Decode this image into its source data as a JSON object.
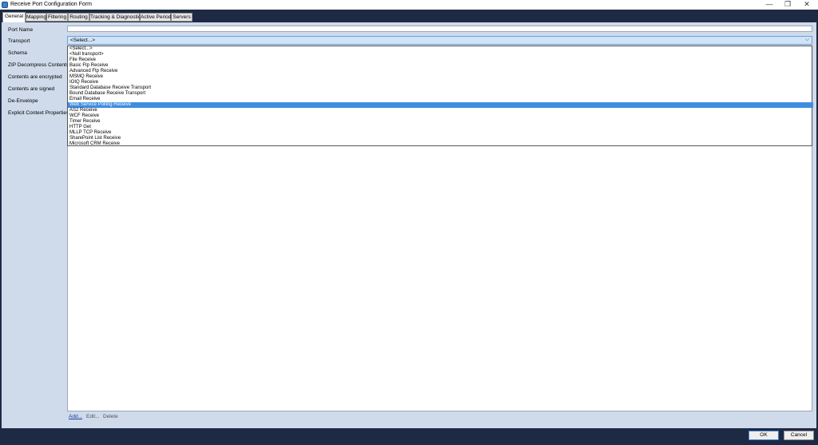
{
  "window": {
    "title": "Receive Port Configuration Form",
    "minimize_glyph": "—",
    "maximize_glyph": "❐",
    "close_glyph": "✕"
  },
  "tabs": [
    "General",
    "Mapping",
    "Filtering",
    "Routing",
    "Tracking & Diagnostics",
    "Active Period",
    "Servers"
  ],
  "active_tab": "General",
  "labels": {
    "port_name": "Port Name",
    "transport": "Transport",
    "schema": "Schema",
    "zip": "ZIP Decompress Contents",
    "encrypted": "Contents are encrypted",
    "signed": "Contents are signed",
    "de_envelope": "De-Envelope",
    "context_props": "Explicit Context Properties"
  },
  "fields": {
    "port_name_value": "",
    "transport_value": "<Select...>"
  },
  "transport_options": [
    "<Select...>",
    "<Null transport>",
    "File Receive",
    "Basic Ftp Receive",
    "Advanced Ftp Receive",
    "MSMQ Receive",
    "IOIQ Receive",
    "Standard Database Receive Transport",
    "Bound Database Receive Transport",
    "Email Receive",
    "Web Service Polling Receive",
    "AS2 Receive",
    "WCF Receive",
    "Timer Receive",
    "HTTP Get",
    "MLLP TCP Receive",
    "SharePoint List Receive",
    "Microsoft CRM Receive"
  ],
  "selected_option_index": 10,
  "actions": {
    "add": "Add...",
    "edit": "Edit...",
    "delete": "Delete"
  },
  "buttons": {
    "ok": "OK",
    "cancel": "Cancel"
  },
  "colors": {
    "selection": "#3e8ee0",
    "content_bg": "#cfdaea",
    "chrome": "#1e2a44"
  }
}
